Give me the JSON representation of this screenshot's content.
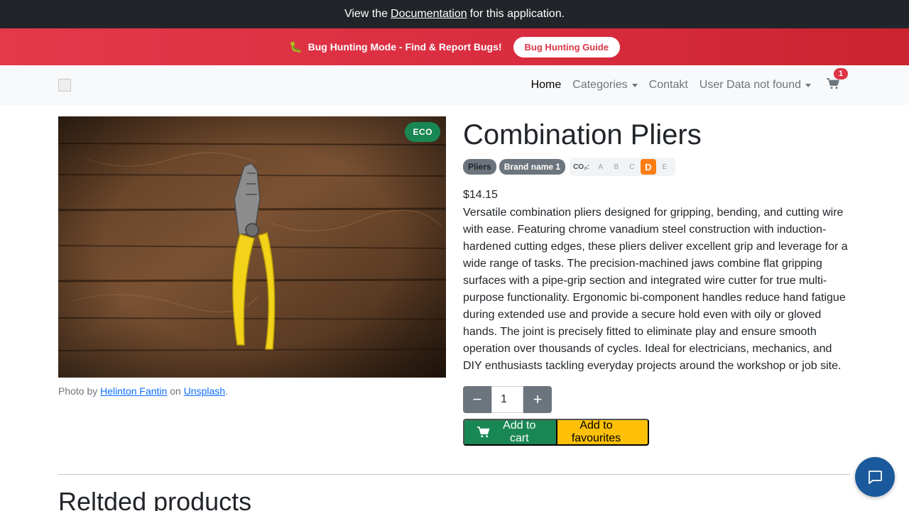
{
  "doc_bar": {
    "prefix": "View the",
    "link": "Documentation",
    "suffix": "for this application."
  },
  "bug_bar": {
    "emoji": "🐛",
    "message": "Bug Hunting Mode - Find & Report Bugs!",
    "guide_button": "Bug Hunting Guide"
  },
  "navbar": {
    "items": [
      {
        "label": "Home",
        "active": true,
        "dropdown": false
      },
      {
        "label": "Categories",
        "active": false,
        "dropdown": true
      },
      {
        "label": "Contakt",
        "active": false,
        "dropdown": false
      },
      {
        "label": "User Data not found",
        "active": false,
        "dropdown": true
      }
    ],
    "cart_count": "1"
  },
  "product": {
    "eco_badge": "ECO",
    "credit": {
      "prefix": "Photo by",
      "author": "Helinton Fantin",
      "middle": "on",
      "site": "Unsplash",
      "suffix": "."
    },
    "title": "Combination Pliers",
    "tags": [
      "Pliers",
      "Brand name 1"
    ],
    "co2": {
      "label": "CO₂:",
      "grades": [
        "A",
        "B",
        "C",
        "D",
        "E"
      ],
      "active": "D"
    },
    "price": "$14.15",
    "description": "Versatile combination pliers designed for gripping, bending, and cutting wire with ease. Featuring chrome vanadium steel construction with induction-hardened cutting edges, these pliers deliver excellent grip and leverage for a wide range of tasks. The precision-machined jaws combine flat gripping surfaces with a pipe-grip section and integrated wire cutter for true multi-purpose functionality. Ergonomic bi-component handles reduce hand fatigue during extended use and provide a secure hold even with oily or gloved hands. The joint is precisely fitted to eliminate play and ensure smooth operation over thousands of cycles. Ideal for electricians, mechanics, and DIY enthusiasts tackling everyday projects around the workshop or job site.",
    "quantity": "1",
    "decrease_symbol": "−",
    "increase_symbol": "+",
    "add_to_cart": "Add to cart",
    "add_to_favourites": "Add to favourites"
  },
  "related": {
    "heading": "Reltded products"
  },
  "colors": {
    "doc_bar": "#212529",
    "bug_bar": "#dc3545",
    "success": "#198754",
    "warning": "#ffc107",
    "secondary": "#6c757d",
    "co2_active": "#fd7e14",
    "chat": "#1a5a9c"
  },
  "icons": {
    "cart": "cart-icon",
    "chat": "chat-icon",
    "bug": "bug-icon"
  }
}
